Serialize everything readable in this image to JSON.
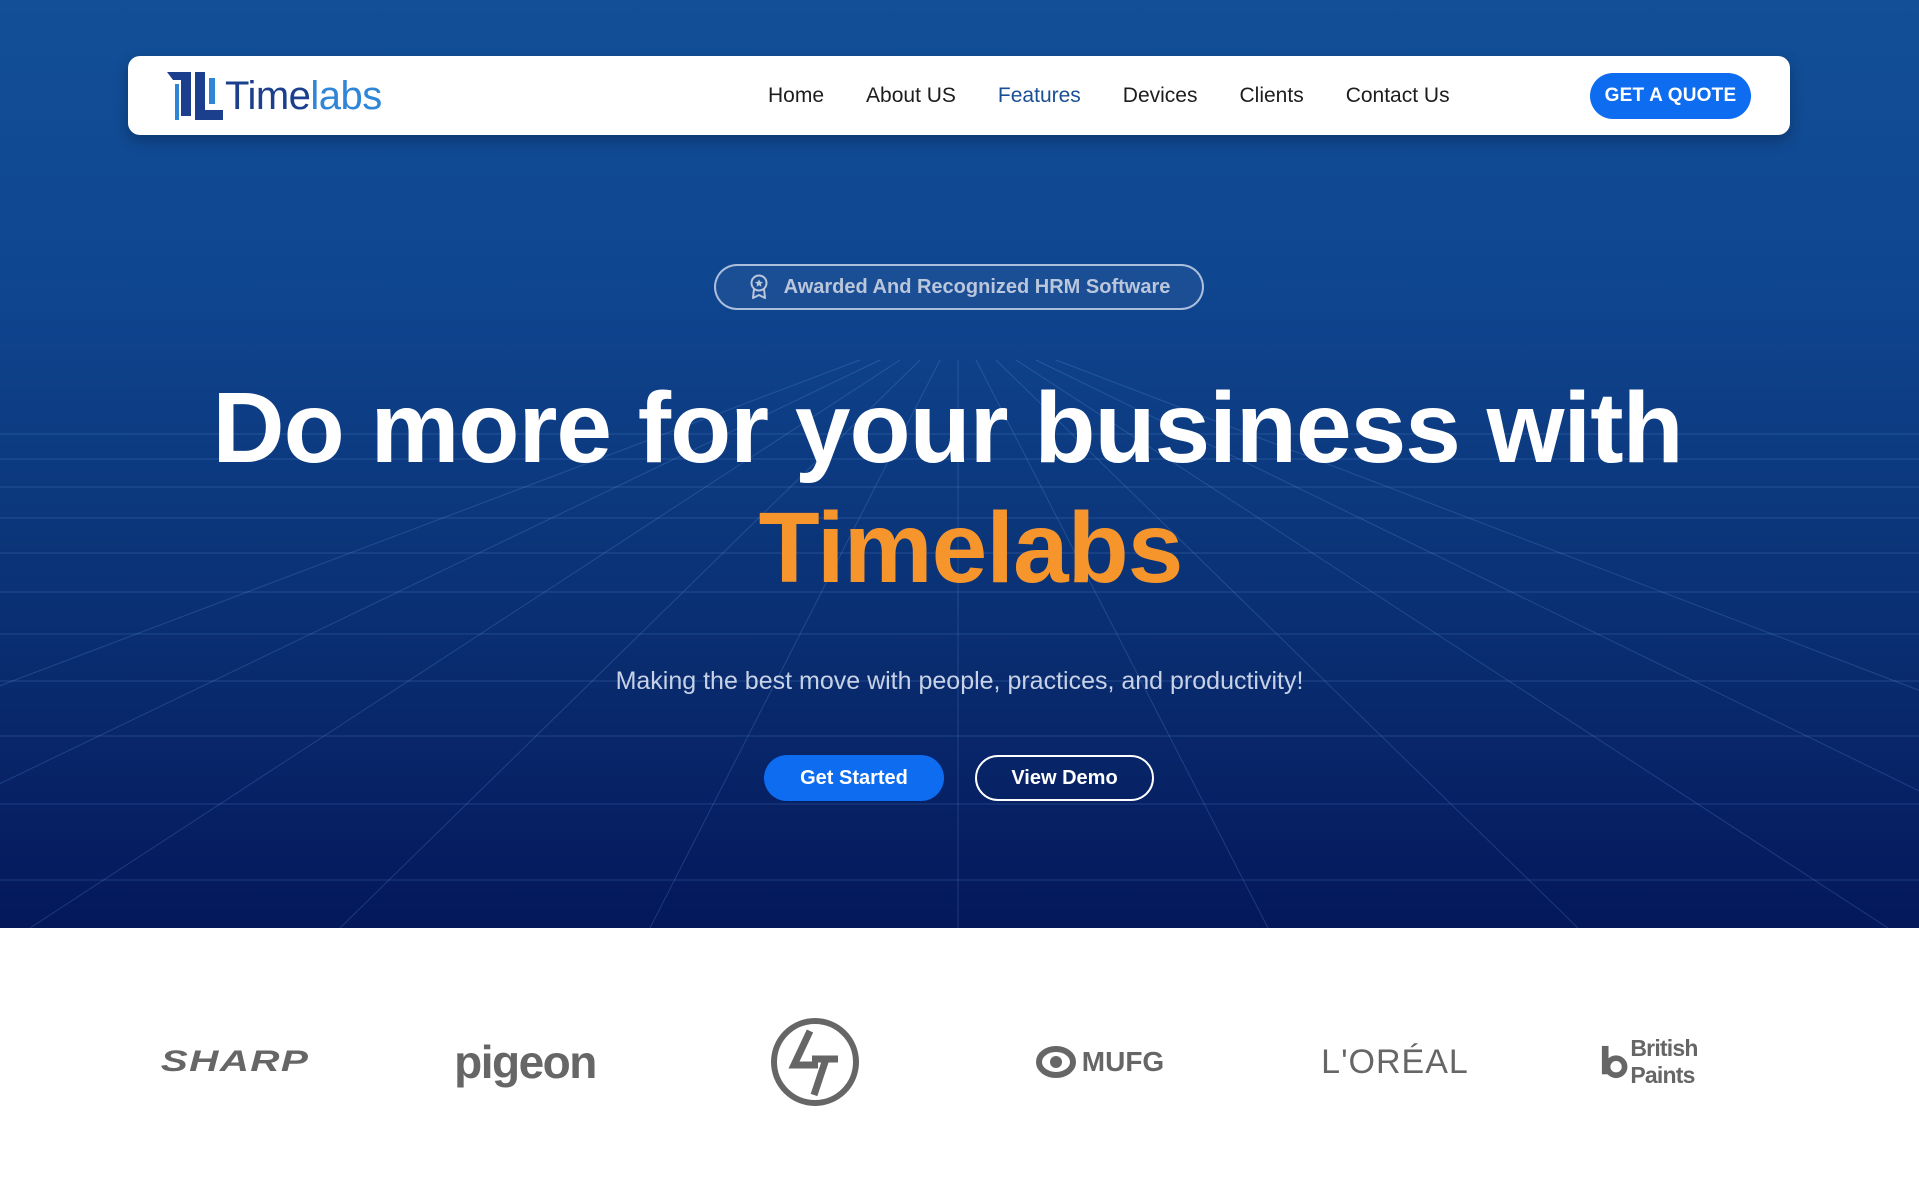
{
  "brand": {
    "logo_time": "Time",
    "logo_labs": "labs"
  },
  "nav": {
    "items": [
      {
        "label": "Home",
        "active": false
      },
      {
        "label": "About US",
        "active": false
      },
      {
        "label": "Features",
        "active": true
      },
      {
        "label": "Devices",
        "active": false
      },
      {
        "label": "Clients",
        "active": false
      },
      {
        "label": "Contact Us",
        "active": false
      }
    ],
    "cta_label": "GET A QUOTE"
  },
  "hero": {
    "badge_text": "Awarded And Recognized HRM Software",
    "badge_icon": "award-ribbon-icon",
    "headline": "Do more for your business with",
    "headline_accent": "Timelabs",
    "subtext": "Making the best move with people, practices, and productivity!",
    "primary_button": "Get Started",
    "secondary_button": "View Demo"
  },
  "clients": {
    "logos": [
      {
        "name": "SHARP"
      },
      {
        "name": "pigeon"
      },
      {
        "name": "L&T",
        "icon": "lt-logo-icon"
      },
      {
        "name": "MUFG"
      },
      {
        "name": "L'ORÉAL"
      },
      {
        "name": "British Paints"
      }
    ]
  },
  "colors": {
    "hero_top": "#124f97",
    "hero_bottom": "#04185a",
    "primary_blue": "#0e6cf0",
    "accent_orange": "#f7952d",
    "active_nav": "#1a4f96",
    "logo_gray": "#666666"
  }
}
